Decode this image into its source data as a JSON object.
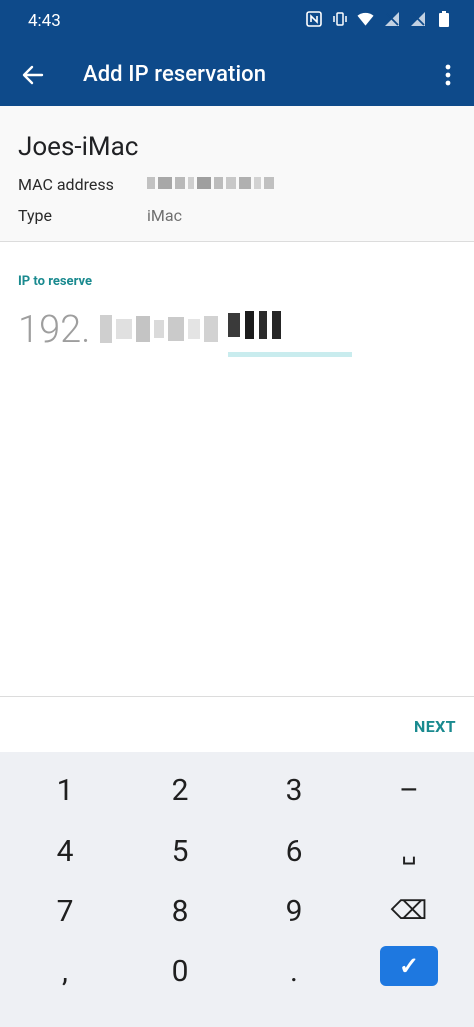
{
  "status_bar": {
    "time": "4:43",
    "icons": [
      "nfc-icon",
      "vibrate-icon",
      "wifi-icon",
      "no-signal-icon",
      "no-signal-icon",
      "battery-icon"
    ]
  },
  "app_bar": {
    "title": "Add IP reservation",
    "background": "#0e4a8a"
  },
  "device": {
    "name": "Joes-iMac",
    "mac_label": "MAC address",
    "type_label": "Type",
    "type_value": "iMac"
  },
  "ip_field": {
    "label": "IP to reserve",
    "visible_prefix": "192.",
    "accent": "#1a8a8f"
  },
  "action": {
    "next_label": "NEXT"
  },
  "keypad": {
    "keys": [
      [
        "1",
        "2",
        "3",
        "–"
      ],
      [
        "4",
        "5",
        "6",
        "␣"
      ],
      [
        "7",
        "8",
        "9",
        "⌫"
      ],
      [
        ",",
        "0",
        ".",
        "✓"
      ]
    ],
    "enter_color": "#1e78e0"
  }
}
